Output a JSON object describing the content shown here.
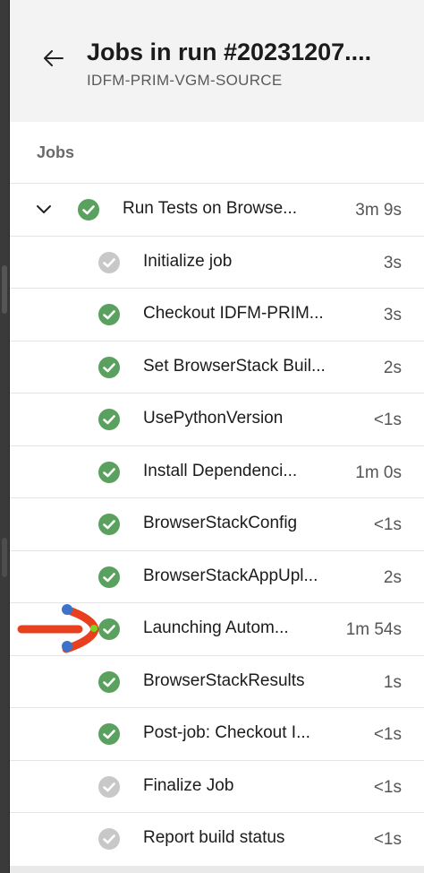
{
  "header": {
    "title": "Jobs in run #20231207....",
    "subtitle": "IDFM-PRIM-VGM-SOURCE"
  },
  "section_label": "Jobs",
  "colors": {
    "success": "#5aa05e",
    "skipped": "#c8c8c8",
    "annotation_arrow": "#e8401f",
    "annotation_dot": "#3d72c9",
    "annotation_point": "#7ed321"
  },
  "job": {
    "name": "Run Tests on Browse...",
    "duration": "3m 9s",
    "status": "success",
    "expanded": true
  },
  "steps": [
    {
      "name": "Initialize job",
      "duration": "3s",
      "status": "skipped"
    },
    {
      "name": "Checkout IDFM-PRIM...",
      "duration": "3s",
      "status": "success"
    },
    {
      "name": "Set BrowserStack Buil...",
      "duration": "2s",
      "status": "success"
    },
    {
      "name": "UsePythonVersion",
      "duration": "<1s",
      "status": "success"
    },
    {
      "name": "Install Dependenci...",
      "duration": "1m 0s",
      "status": "success"
    },
    {
      "name": "BrowserStackConfig",
      "duration": "<1s",
      "status": "success"
    },
    {
      "name": "BrowserStackAppUpl...",
      "duration": "2s",
      "status": "success"
    },
    {
      "name": "Launching Autom...",
      "duration": "1m 54s",
      "status": "success"
    },
    {
      "name": "BrowserStackResults",
      "duration": "1s",
      "status": "success"
    },
    {
      "name": "Post-job: Checkout I...",
      "duration": "<1s",
      "status": "success"
    },
    {
      "name": "Finalize Job",
      "duration": "<1s",
      "status": "skipped"
    },
    {
      "name": "Report build status",
      "duration": "<1s",
      "status": "skipped"
    }
  ]
}
